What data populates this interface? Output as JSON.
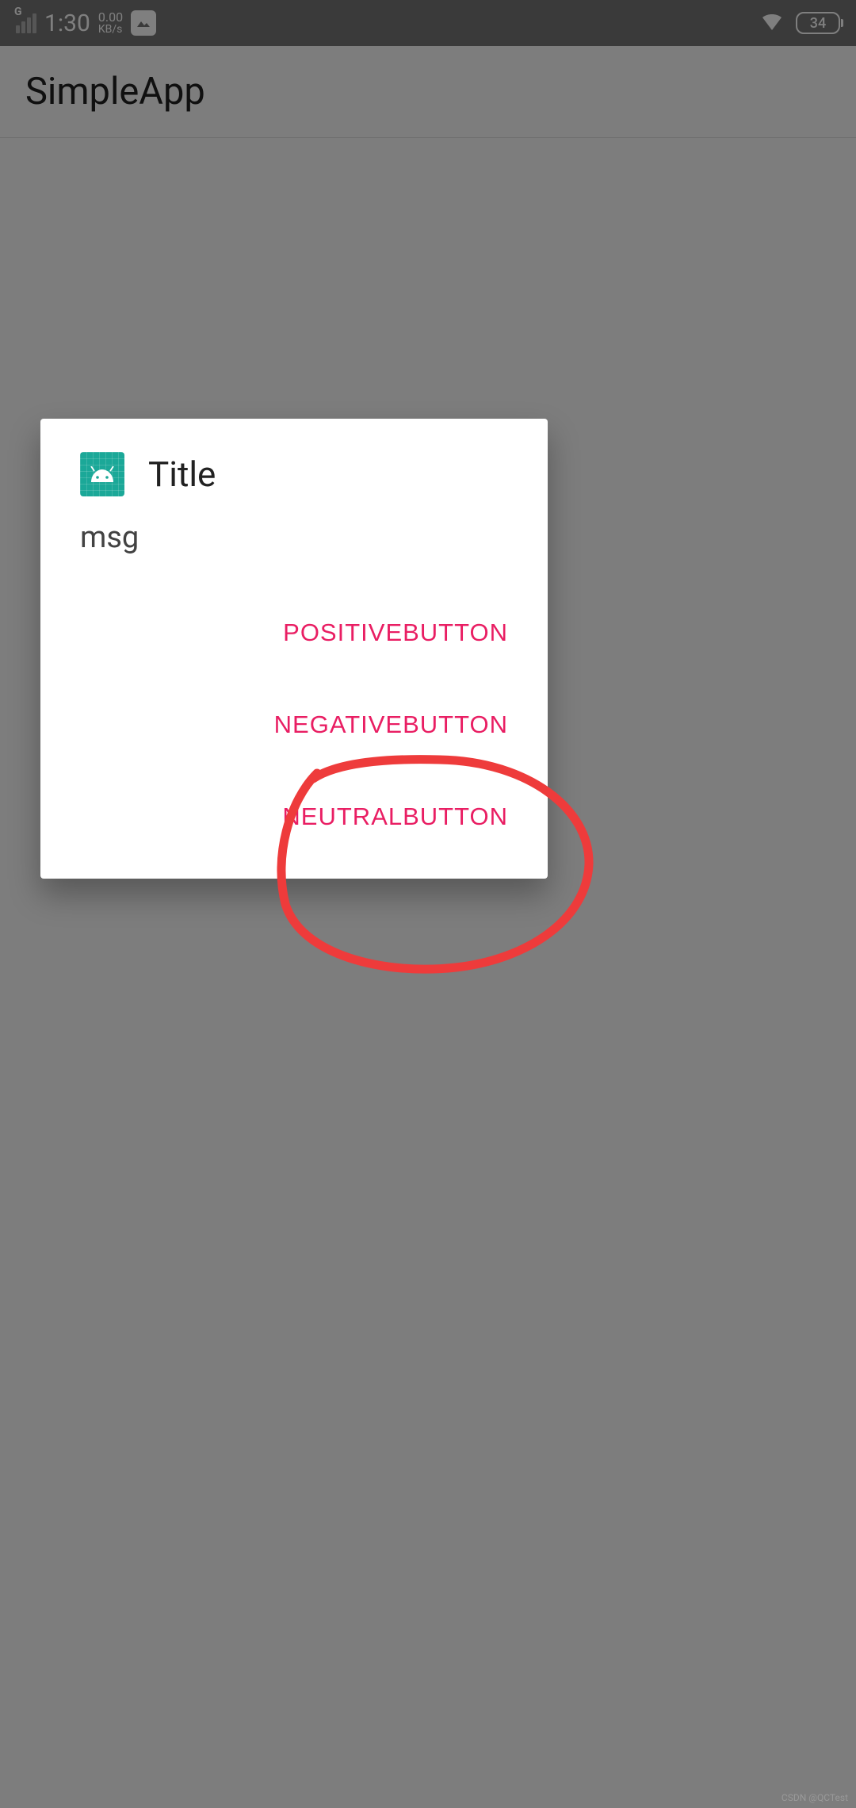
{
  "status_bar": {
    "network_type": "G",
    "time": "1:30",
    "data_rate_value": "0.00",
    "data_rate_unit": "KB/s",
    "battery_level": "34"
  },
  "app_bar": {
    "title": "SimpleApp"
  },
  "dialog": {
    "icon": "android-icon",
    "title": "Title",
    "message": "msg",
    "positive_button": "POSITIVEBUTTON",
    "negative_button": "NEGATIVEBUTTON",
    "neutral_button": "NEUTRALBUTTON"
  },
  "annotation": {
    "type": "hand-drawn-circle",
    "color": "#ee3b3b",
    "target": "neutral_button"
  },
  "watermark": "CSDN @QCTest"
}
